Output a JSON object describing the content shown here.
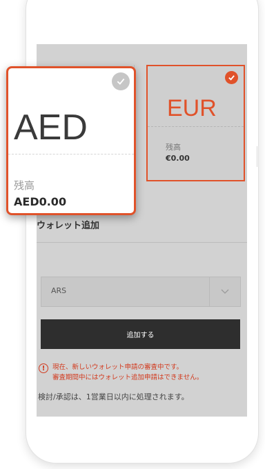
{
  "wallets": [
    {
      "code": "AED",
      "balance_label": "残高",
      "balance": "AED0.00"
    },
    {
      "code": "EUR",
      "balance_label": "残高",
      "balance": "€0.00"
    }
  ],
  "add_wallet": {
    "title": "ウォレット追加",
    "currency_selected": "ARS",
    "button_label": "追加する"
  },
  "notice": {
    "line1": "現在、新しいウォレット申請の審査中です。",
    "line2": "審査期間中にはウォレット追加申請はできません。"
  },
  "review_note": "検討/承認は、1営業日以内に処理されます。",
  "colors": {
    "accent": "#e0522a",
    "warning": "#d23a1e",
    "button_bg": "#2e2e2e",
    "overlay_bg": "#d2d2d2"
  }
}
